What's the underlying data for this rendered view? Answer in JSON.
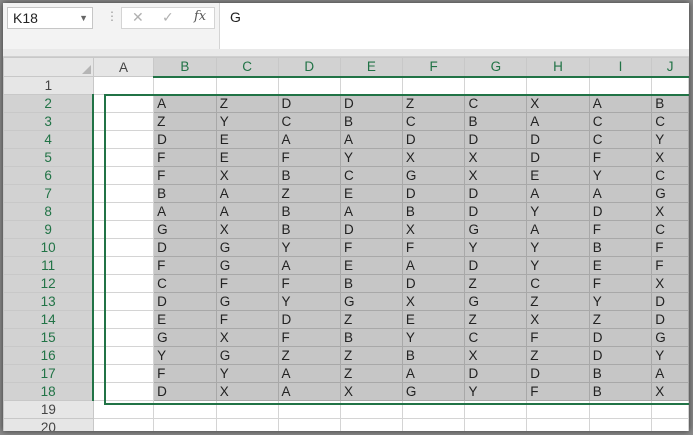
{
  "formula_bar": {
    "name_box": "K18",
    "cancel_icon": "✕",
    "enter_icon": "✓",
    "fx_label": "fx",
    "formula_value": "G"
  },
  "grid": {
    "columns": [
      "A",
      "B",
      "C",
      "D",
      "E",
      "F",
      "G",
      "H",
      "I",
      "J"
    ],
    "selected_columns": [
      "B",
      "C",
      "D",
      "E",
      "F",
      "G",
      "H",
      "I",
      "J"
    ],
    "rows": [
      {
        "n": "1",
        "cells": [
          "",
          "",
          "",
          "",
          "",
          "",
          "",
          "",
          "",
          ""
        ]
      },
      {
        "n": "2",
        "cells": [
          "",
          "A",
          "Z",
          "D",
          "D",
          "Z",
          "C",
          "X",
          "A",
          "B"
        ]
      },
      {
        "n": "3",
        "cells": [
          "",
          "Z",
          "Y",
          "C",
          "B",
          "C",
          "B",
          "A",
          "C",
          "C"
        ]
      },
      {
        "n": "4",
        "cells": [
          "",
          "D",
          "E",
          "A",
          "A",
          "D",
          "D",
          "D",
          "C",
          "Y"
        ]
      },
      {
        "n": "5",
        "cells": [
          "",
          "F",
          "E",
          "F",
          "Y",
          "X",
          "X",
          "D",
          "F",
          "X"
        ]
      },
      {
        "n": "6",
        "cells": [
          "",
          "F",
          "X",
          "B",
          "C",
          "G",
          "X",
          "E",
          "Y",
          "C"
        ]
      },
      {
        "n": "7",
        "cells": [
          "",
          "B",
          "A",
          "Z",
          "E",
          "D",
          "D",
          "A",
          "A",
          "G"
        ]
      },
      {
        "n": "8",
        "cells": [
          "",
          "A",
          "A",
          "B",
          "A",
          "B",
          "D",
          "Y",
          "D",
          "X"
        ]
      },
      {
        "n": "9",
        "cells": [
          "",
          "G",
          "X",
          "B",
          "D",
          "X",
          "G",
          "A",
          "F",
          "C"
        ]
      },
      {
        "n": "10",
        "cells": [
          "",
          "D",
          "G",
          "Y",
          "F",
          "F",
          "Y",
          "Y",
          "B",
          "F"
        ]
      },
      {
        "n": "11",
        "cells": [
          "",
          "F",
          "G",
          "A",
          "E",
          "A",
          "D",
          "Y",
          "E",
          "F"
        ]
      },
      {
        "n": "12",
        "cells": [
          "",
          "C",
          "F",
          "F",
          "B",
          "D",
          "Z",
          "C",
          "F",
          "X"
        ]
      },
      {
        "n": "13",
        "cells": [
          "",
          "D",
          "G",
          "Y",
          "G",
          "X",
          "G",
          "Z",
          "Y",
          "D"
        ]
      },
      {
        "n": "14",
        "cells": [
          "",
          "E",
          "F",
          "D",
          "Z",
          "E",
          "Z",
          "X",
          "Z",
          "D"
        ]
      },
      {
        "n": "15",
        "cells": [
          "",
          "G",
          "X",
          "F",
          "B",
          "Y",
          "C",
          "F",
          "D",
          "G"
        ]
      },
      {
        "n": "16",
        "cells": [
          "",
          "Y",
          "G",
          "Z",
          "Z",
          "B",
          "X",
          "Z",
          "D",
          "Y"
        ]
      },
      {
        "n": "17",
        "cells": [
          "",
          "F",
          "Y",
          "A",
          "Z",
          "A",
          "D",
          "D",
          "B",
          "A"
        ]
      },
      {
        "n": "18",
        "cells": [
          "",
          "D",
          "X",
          "A",
          "X",
          "G",
          "Y",
          "F",
          "B",
          "X"
        ]
      },
      {
        "n": "19",
        "cells": [
          "",
          "",
          "",
          "",
          "",
          "",
          "",
          "",
          "",
          ""
        ]
      },
      {
        "n": "20",
        "cells": [
          "",
          "",
          "",
          "",
          "",
          "",
          "",
          "",
          "",
          ""
        ]
      }
    ],
    "selected_rows": [
      "2",
      "3",
      "4",
      "5",
      "6",
      "7",
      "8",
      "9",
      "10",
      "11",
      "12",
      "13",
      "14",
      "15",
      "16",
      "17",
      "18"
    ]
  },
  "colors": {
    "accent": "#217346",
    "selection_fill": "#c6c6c6"
  }
}
